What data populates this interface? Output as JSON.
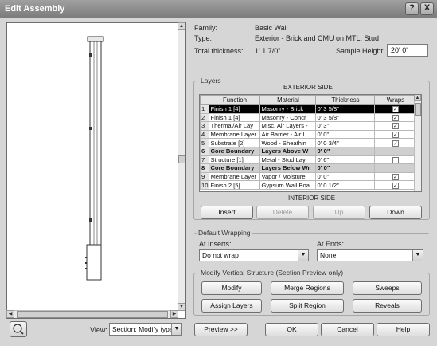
{
  "window": {
    "title": "Edit Assembly",
    "help_glyph": "?",
    "close_glyph": "X"
  },
  "properties": {
    "family_label": "Family:",
    "family_value": "Basic Wall",
    "type_label": "Type:",
    "type_value": "Exterior - Brick and CMU on MTL. Stud",
    "thickness_label": "Total thickness:",
    "thickness_value": "1'  1 7/0\"",
    "sample_height_label": "Sample Height:",
    "sample_height_value": "20'  0\""
  },
  "layers": {
    "group_title": "Layers",
    "exterior_label": "EXTERIOR SIDE",
    "interior_label": "INTERIOR SIDE",
    "columns": [
      "",
      "Function",
      "Material",
      "Thickness",
      "Wraps"
    ],
    "rows": [
      {
        "num": "1",
        "function": "Finish 1 [4]",
        "material": "Masonry - Brick",
        "thickness": "0'  3 5/8\"",
        "wraps": true,
        "style": "sel"
      },
      {
        "num": "2",
        "function": "Finish 1 [4]",
        "material": "Masonry - Concr",
        "thickness": "0'  3 5/8\"",
        "wraps": true,
        "style": ""
      },
      {
        "num": "3",
        "function": "Thermal/Air Lay",
        "material": "Misc. Air Layers -",
        "thickness": "0'  3\"",
        "wraps": true,
        "style": ""
      },
      {
        "num": "4",
        "function": "Membrane Layer",
        "material": "Air Barrier - Air I",
        "thickness": "0'  0\"",
        "wraps": true,
        "style": ""
      },
      {
        "num": "5",
        "function": "Substrate [2]",
        "material": "Wood - Sheathin",
        "thickness": "0'  0 3/4\"",
        "wraps": true,
        "style": ""
      },
      {
        "num": "6",
        "function": "Core Boundary",
        "material": "Layers Above W",
        "thickness": "0'  0\"",
        "wraps": null,
        "style": "core"
      },
      {
        "num": "7",
        "function": "Structure [1]",
        "material": "Metal - Stud Lay",
        "thickness": "0'  6\"",
        "wraps": false,
        "style": ""
      },
      {
        "num": "8",
        "function": "Core Boundary",
        "material": "Layers Below Wr",
        "thickness": "0'  0\"",
        "wraps": null,
        "style": "core"
      },
      {
        "num": "9",
        "function": "Membrane Layer",
        "material": "Vapor / Moisture",
        "thickness": "0'  0\"",
        "wraps": true,
        "style": ""
      },
      {
        "num": "10",
        "function": "Finish 2 [5]",
        "material": "Gypsum Wall Boa",
        "thickness": "0'  0 1/2\"",
        "wraps": true,
        "style": ""
      }
    ],
    "buttons": {
      "insert": "Insert",
      "delete": "Delete",
      "up": "Up",
      "down": "Down"
    }
  },
  "default_wrapping": {
    "group_title": "Default Wrapping",
    "at_inserts_label": "At Inserts:",
    "at_inserts_value": "Do not wrap",
    "at_ends_label": "At Ends:",
    "at_ends_value": "None"
  },
  "modify": {
    "group_title": "Modify Vertical Structure (Section Preview only)",
    "modify": "Modify",
    "merge_regions": "Merge Regions",
    "sweeps": "Sweeps",
    "assign_layers": "Assign Layers",
    "split_region": "Split Region",
    "reveals": "Reveals"
  },
  "footer": {
    "view_label": "View:",
    "view_value": "Section: Modify type",
    "preview_button": "Preview >>",
    "ok": "OK",
    "cancel": "Cancel",
    "help": "Help"
  }
}
